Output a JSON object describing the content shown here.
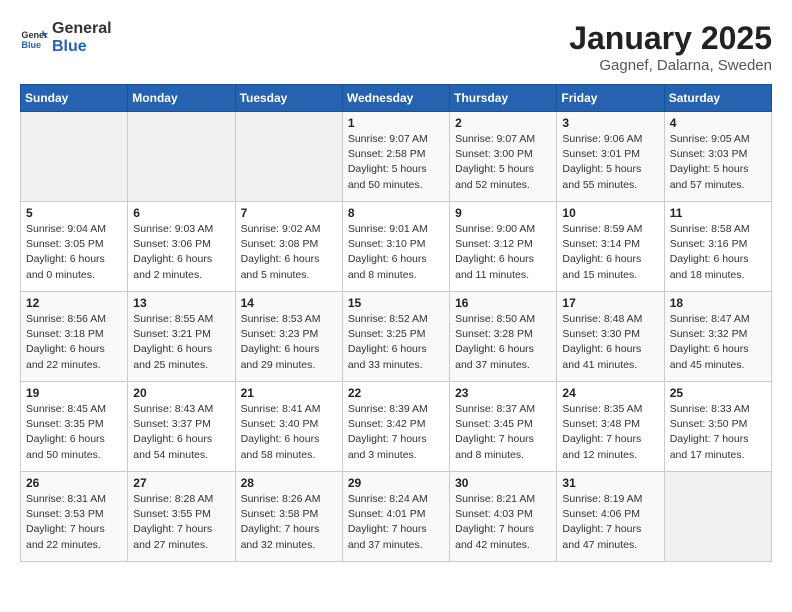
{
  "header": {
    "logo": {
      "text_general": "General",
      "text_blue": "Blue"
    },
    "title": "January 2025",
    "location": "Gagnef, Dalarna, Sweden"
  },
  "calendar": {
    "weekdays": [
      "Sunday",
      "Monday",
      "Tuesday",
      "Wednesday",
      "Thursday",
      "Friday",
      "Saturday"
    ],
    "weeks": [
      [
        {
          "day": "",
          "info": ""
        },
        {
          "day": "",
          "info": ""
        },
        {
          "day": "",
          "info": ""
        },
        {
          "day": "1",
          "info": "Sunrise: 9:07 AM\nSunset: 2:58 PM\nDaylight: 5 hours\nand 50 minutes."
        },
        {
          "day": "2",
          "info": "Sunrise: 9:07 AM\nSunset: 3:00 PM\nDaylight: 5 hours\nand 52 minutes."
        },
        {
          "day": "3",
          "info": "Sunrise: 9:06 AM\nSunset: 3:01 PM\nDaylight: 5 hours\nand 55 minutes."
        },
        {
          "day": "4",
          "info": "Sunrise: 9:05 AM\nSunset: 3:03 PM\nDaylight: 5 hours\nand 57 minutes."
        }
      ],
      [
        {
          "day": "5",
          "info": "Sunrise: 9:04 AM\nSunset: 3:05 PM\nDaylight: 6 hours\nand 0 minutes."
        },
        {
          "day": "6",
          "info": "Sunrise: 9:03 AM\nSunset: 3:06 PM\nDaylight: 6 hours\nand 2 minutes."
        },
        {
          "day": "7",
          "info": "Sunrise: 9:02 AM\nSunset: 3:08 PM\nDaylight: 6 hours\nand 5 minutes."
        },
        {
          "day": "8",
          "info": "Sunrise: 9:01 AM\nSunset: 3:10 PM\nDaylight: 6 hours\nand 8 minutes."
        },
        {
          "day": "9",
          "info": "Sunrise: 9:00 AM\nSunset: 3:12 PM\nDaylight: 6 hours\nand 11 minutes."
        },
        {
          "day": "10",
          "info": "Sunrise: 8:59 AM\nSunset: 3:14 PM\nDaylight: 6 hours\nand 15 minutes."
        },
        {
          "day": "11",
          "info": "Sunrise: 8:58 AM\nSunset: 3:16 PM\nDaylight: 6 hours\nand 18 minutes."
        }
      ],
      [
        {
          "day": "12",
          "info": "Sunrise: 8:56 AM\nSunset: 3:18 PM\nDaylight: 6 hours\nand 22 minutes."
        },
        {
          "day": "13",
          "info": "Sunrise: 8:55 AM\nSunset: 3:21 PM\nDaylight: 6 hours\nand 25 minutes."
        },
        {
          "day": "14",
          "info": "Sunrise: 8:53 AM\nSunset: 3:23 PM\nDaylight: 6 hours\nand 29 minutes."
        },
        {
          "day": "15",
          "info": "Sunrise: 8:52 AM\nSunset: 3:25 PM\nDaylight: 6 hours\nand 33 minutes."
        },
        {
          "day": "16",
          "info": "Sunrise: 8:50 AM\nSunset: 3:28 PM\nDaylight: 6 hours\nand 37 minutes."
        },
        {
          "day": "17",
          "info": "Sunrise: 8:48 AM\nSunset: 3:30 PM\nDaylight: 6 hours\nand 41 minutes."
        },
        {
          "day": "18",
          "info": "Sunrise: 8:47 AM\nSunset: 3:32 PM\nDaylight: 6 hours\nand 45 minutes."
        }
      ],
      [
        {
          "day": "19",
          "info": "Sunrise: 8:45 AM\nSunset: 3:35 PM\nDaylight: 6 hours\nand 50 minutes."
        },
        {
          "day": "20",
          "info": "Sunrise: 8:43 AM\nSunset: 3:37 PM\nDaylight: 6 hours\nand 54 minutes."
        },
        {
          "day": "21",
          "info": "Sunrise: 8:41 AM\nSunset: 3:40 PM\nDaylight: 6 hours\nand 58 minutes."
        },
        {
          "day": "22",
          "info": "Sunrise: 8:39 AM\nSunset: 3:42 PM\nDaylight: 7 hours\nand 3 minutes."
        },
        {
          "day": "23",
          "info": "Sunrise: 8:37 AM\nSunset: 3:45 PM\nDaylight: 7 hours\nand 8 minutes."
        },
        {
          "day": "24",
          "info": "Sunrise: 8:35 AM\nSunset: 3:48 PM\nDaylight: 7 hours\nand 12 minutes."
        },
        {
          "day": "25",
          "info": "Sunrise: 8:33 AM\nSunset: 3:50 PM\nDaylight: 7 hours\nand 17 minutes."
        }
      ],
      [
        {
          "day": "26",
          "info": "Sunrise: 8:31 AM\nSunset: 3:53 PM\nDaylight: 7 hours\nand 22 minutes."
        },
        {
          "day": "27",
          "info": "Sunrise: 8:28 AM\nSunset: 3:55 PM\nDaylight: 7 hours\nand 27 minutes."
        },
        {
          "day": "28",
          "info": "Sunrise: 8:26 AM\nSunset: 3:58 PM\nDaylight: 7 hours\nand 32 minutes."
        },
        {
          "day": "29",
          "info": "Sunrise: 8:24 AM\nSunset: 4:01 PM\nDaylight: 7 hours\nand 37 minutes."
        },
        {
          "day": "30",
          "info": "Sunrise: 8:21 AM\nSunset: 4:03 PM\nDaylight: 7 hours\nand 42 minutes."
        },
        {
          "day": "31",
          "info": "Sunrise: 8:19 AM\nSunset: 4:06 PM\nDaylight: 7 hours\nand 47 minutes."
        },
        {
          "day": "",
          "info": ""
        }
      ]
    ]
  }
}
